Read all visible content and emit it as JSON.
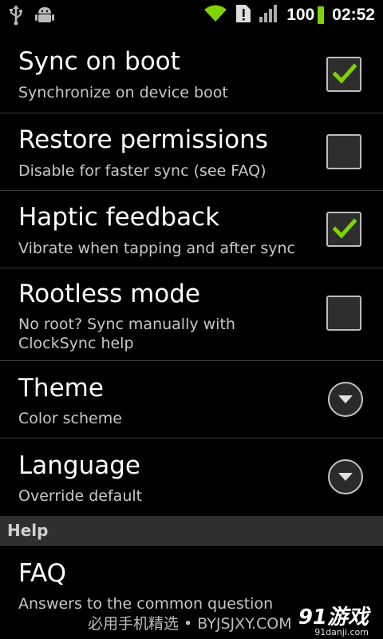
{
  "statusbar": {
    "icons_left": [
      "usb-icon",
      "android-debug-icon"
    ],
    "icons_right": [
      "wifi-icon",
      "alert-icon",
      "signal-icon"
    ],
    "battery_level": "100",
    "time": "02:52",
    "battery_color": "#7fd300",
    "wifi_color": "#7fd300"
  },
  "settings": [
    {
      "title": "Sync on boot",
      "subtitle": "Synchronize on device boot",
      "control": "checkbox",
      "checked": true
    },
    {
      "title": "Restore permissions",
      "subtitle": "Disable for faster sync (see FAQ)",
      "control": "checkbox",
      "checked": false
    },
    {
      "title": "Haptic feedback",
      "subtitle": "Vibrate when tapping and after sync",
      "control": "checkbox",
      "checked": true
    },
    {
      "title": "Rootless mode",
      "subtitle": "No root? Sync manually with ClockSync help",
      "control": "checkbox",
      "checked": false
    },
    {
      "title": "Theme",
      "subtitle": "Color scheme",
      "control": "dropdown"
    },
    {
      "title": "Language",
      "subtitle": "Override default",
      "control": "dropdown"
    }
  ],
  "help_section": {
    "header": "Help",
    "items": [
      {
        "title": "FAQ",
        "subtitle": "Answers to the common questions"
      }
    ]
  },
  "watermark": {
    "text": "必用手机精选 • BYJSJXY.COM",
    "logo": "91游戏",
    "logo_sub": "91danji.com"
  },
  "colors": {
    "check_green": "#7fd300",
    "section_header_bg": "#2f2f2f"
  }
}
